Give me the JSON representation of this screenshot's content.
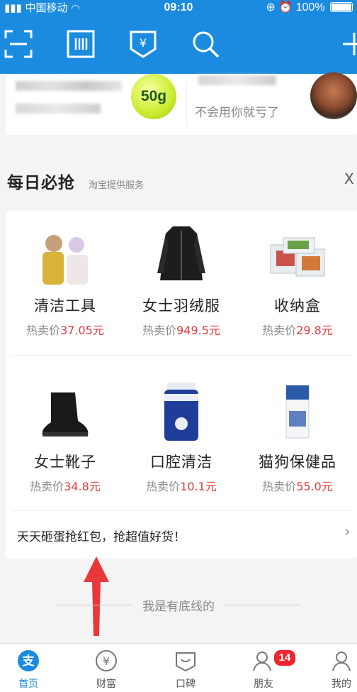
{
  "status_bar": {
    "carrier": "中国移动",
    "time": "09:10",
    "battery": "100%"
  },
  "toolbar": {
    "icons": [
      "scan-icon",
      "barcode-icon",
      "payment-code-icon",
      "search-icon",
      "add-icon"
    ]
  },
  "promo": {
    "ball_label": "50g",
    "subtitle": "不会用你就亏了"
  },
  "section": {
    "title": "每日必抢",
    "subtitle": "淘宝提供服务",
    "close": "X"
  },
  "products": [
    {
      "name": "清洁工具",
      "price_label": "热卖价",
      "price": "37.05元"
    },
    {
      "name": "女士羽绒服",
      "price_label": "热卖价",
      "price": "949.5元"
    },
    {
      "name": "收纳盒",
      "price_label": "热卖价",
      "price": "29.8元"
    },
    {
      "name": "女士靴子",
      "price_label": "热卖价",
      "price": "34.8元"
    },
    {
      "name": "口腔清洁",
      "price_label": "热卖价",
      "price": "10.1元"
    },
    {
      "name": "猫狗保健品",
      "price_label": "热卖价",
      "price": "55.0元"
    }
  ],
  "banner": {
    "text": "天天砸蛋抢红包，抢超值好货！"
  },
  "footer_note": "我是有底线的",
  "tabs": [
    {
      "label": "首页",
      "icon": "alipay-home-icon",
      "active": true
    },
    {
      "label": "财富",
      "icon": "wealth-icon",
      "active": false
    },
    {
      "label": "口碑",
      "icon": "koubei-icon",
      "active": false
    },
    {
      "label": "朋友",
      "icon": "friends-icon",
      "active": false
    },
    {
      "label": "我的",
      "icon": "profile-icon",
      "active": false
    }
  ],
  "friends_badge": "14",
  "colors": {
    "brand": "#1b8be0",
    "price": "#e4393c",
    "badge": "#f0242d"
  }
}
